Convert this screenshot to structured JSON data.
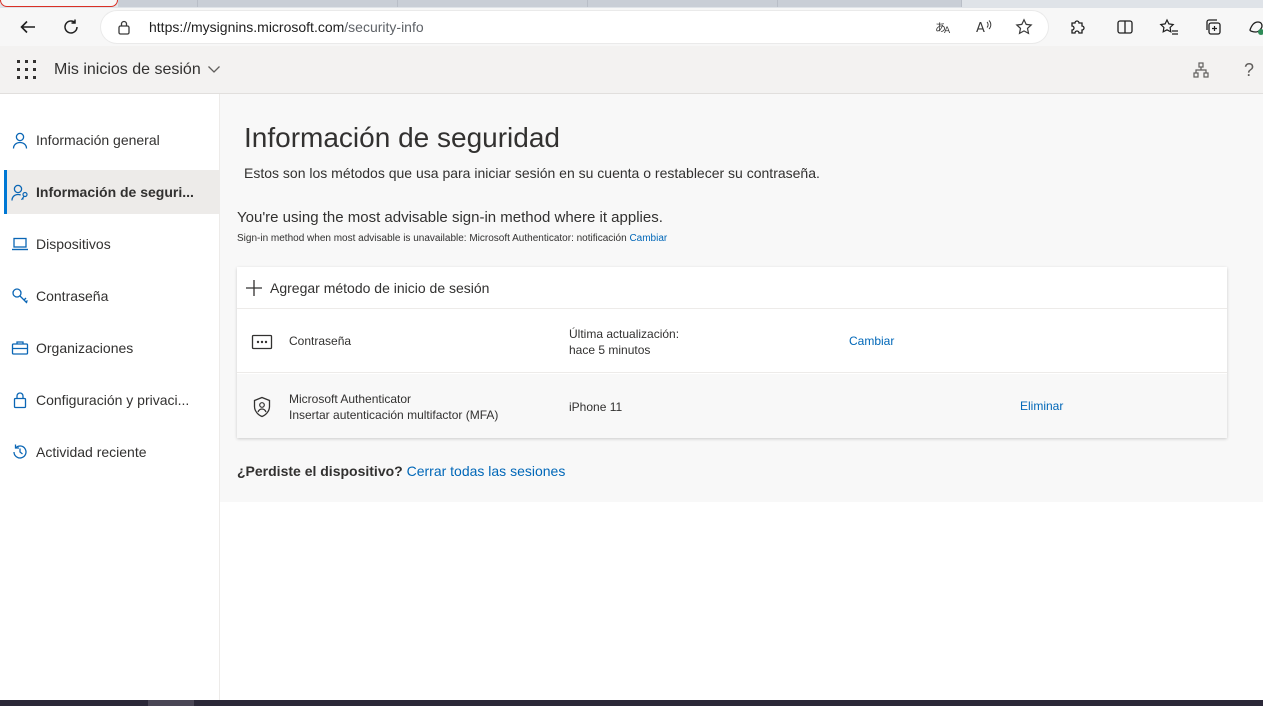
{
  "browser": {
    "url_host": "https://mysignins.microsoft.com",
    "url_path": "/security-info",
    "toolbar_icons": [
      "back-icon",
      "refresh-icon",
      "lock-icon",
      "translate-icon",
      "read-aloud-icon",
      "favorite-star-icon",
      "extensions-icon",
      "split-screen-icon",
      "favorites-icon",
      "collections-icon",
      "copilot-icon"
    ]
  },
  "appbar": {
    "title": "Mis inicios de sesión",
    "icons": [
      "waffle-icon",
      "chevron-down-icon",
      "org-chart-icon",
      "help-icon"
    ],
    "help_glyph": "?"
  },
  "sidebar": {
    "items": [
      {
        "label": "Información general",
        "icon": "person-icon",
        "selected": false
      },
      {
        "label": "Información de seguri...",
        "icon": "person-key-icon",
        "selected": true
      },
      {
        "label": "Dispositivos",
        "icon": "laptop-icon",
        "selected": false
      },
      {
        "label": "Contraseña",
        "icon": "key-icon",
        "selected": false
      },
      {
        "label": "Organizaciones",
        "icon": "briefcase-icon",
        "selected": false
      },
      {
        "label": "Configuración y privaci...",
        "icon": "lock-icon",
        "selected": false
      },
      {
        "label": "Actividad reciente",
        "icon": "history-icon",
        "selected": false
      }
    ]
  },
  "main": {
    "title": "Información de seguridad",
    "description": "Estos son los métodos que usa para iniciar sesión en su cuenta o restablecer su contraseña.",
    "advisable": "You're using the most advisable sign-in method where it applies.",
    "advisable_sub": "Sign-in method when most advisable is unavailable: Microsoft Authenticator: notificación",
    "advisable_link": "Cambiar",
    "add_method": "Agregar método de inicio de sesión",
    "methods": [
      {
        "name": "Contraseña",
        "detail_line1": "Última actualización:",
        "detail_line2": "hace 5 minutos",
        "action": "Cambiar",
        "icon": "password-dots-icon"
      },
      {
        "name": "Microsoft Authenticator",
        "name_line2": "Insertar autenticación multifactor (MFA)",
        "detail_line1": "iPhone 11",
        "action": "Eliminar",
        "icon": "authenticator-icon"
      }
    ],
    "lost_device_question": "¿Perdiste el dispositivo?",
    "lost_device_link": "Cerrar todas las sesiones"
  },
  "colors": {
    "accent": "#0078d4",
    "link": "#0067b8",
    "text": "#323130"
  }
}
